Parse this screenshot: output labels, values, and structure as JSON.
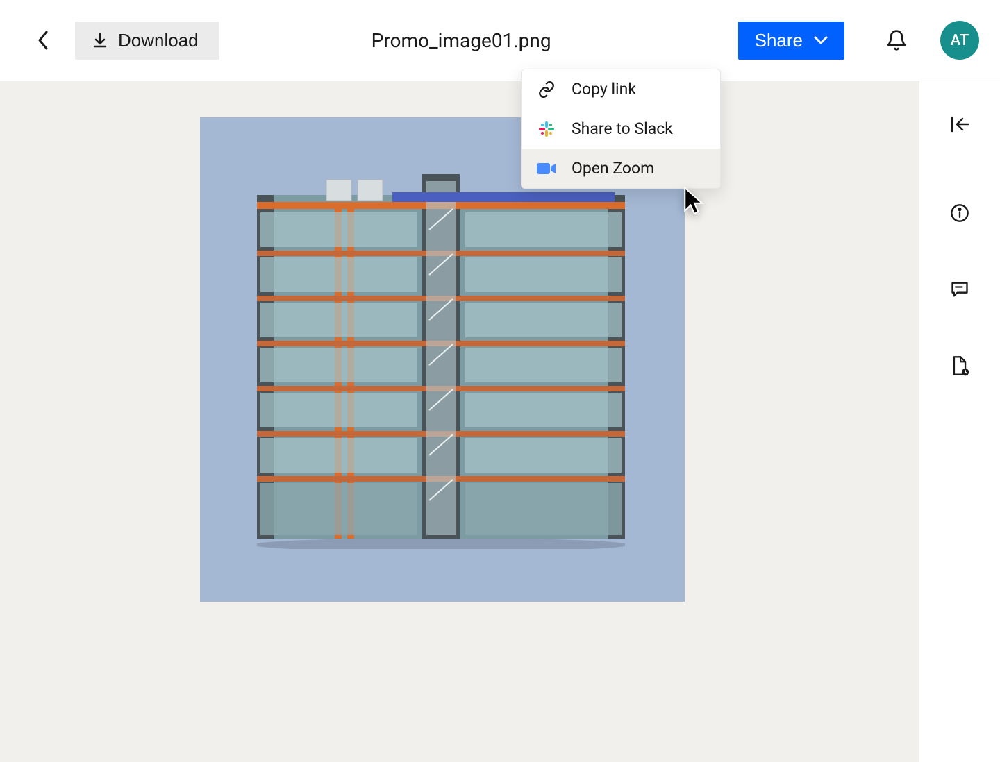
{
  "header": {
    "download_label": "Download",
    "file_title": "Promo_image01.png",
    "share_label": "Share",
    "avatar_initials": "AT"
  },
  "share_menu": {
    "items": [
      {
        "label": "Copy link",
        "icon": "link-icon"
      },
      {
        "label": "Share to Slack",
        "icon": "slack-icon"
      },
      {
        "label": "Open Zoom",
        "icon": "zoom-icon"
      }
    ],
    "hovered_index": 2
  },
  "right_rail": {
    "items": [
      {
        "name": "collapse-panel-icon"
      },
      {
        "name": "info-icon"
      },
      {
        "name": "comments-icon"
      },
      {
        "name": "file-activity-icon"
      }
    ]
  },
  "colors": {
    "primary": "#0061fe",
    "avatar_bg": "#178f8c",
    "canvas_bg": "#f2f0ed",
    "preview_bg": "#a4b8d4"
  }
}
